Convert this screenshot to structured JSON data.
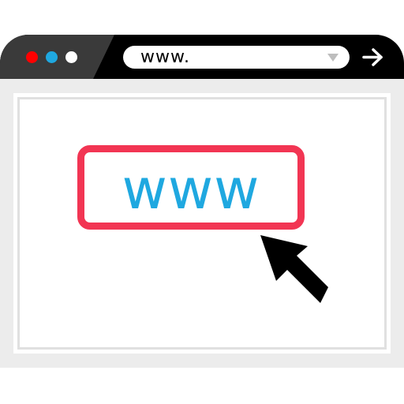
{
  "window": {
    "controls": [
      {
        "name": "close-dot",
        "color": "#ff0000"
      },
      {
        "name": "minimize-dot",
        "color": "#1fa8e0"
      },
      {
        "name": "maximize-dot",
        "color": "#ffffff"
      }
    ],
    "titlebar_color": "#000000",
    "address_bar": {
      "value": "www.",
      "dropdown_icon": "chevron-down-icon"
    },
    "go_icon": "arrow-right-icon"
  },
  "content": {
    "url_highlight_text": "www",
    "highlight_border_color": "#f23553",
    "text_color": "#1fa8e0",
    "cursor_icon": "mouse-pointer-icon"
  }
}
